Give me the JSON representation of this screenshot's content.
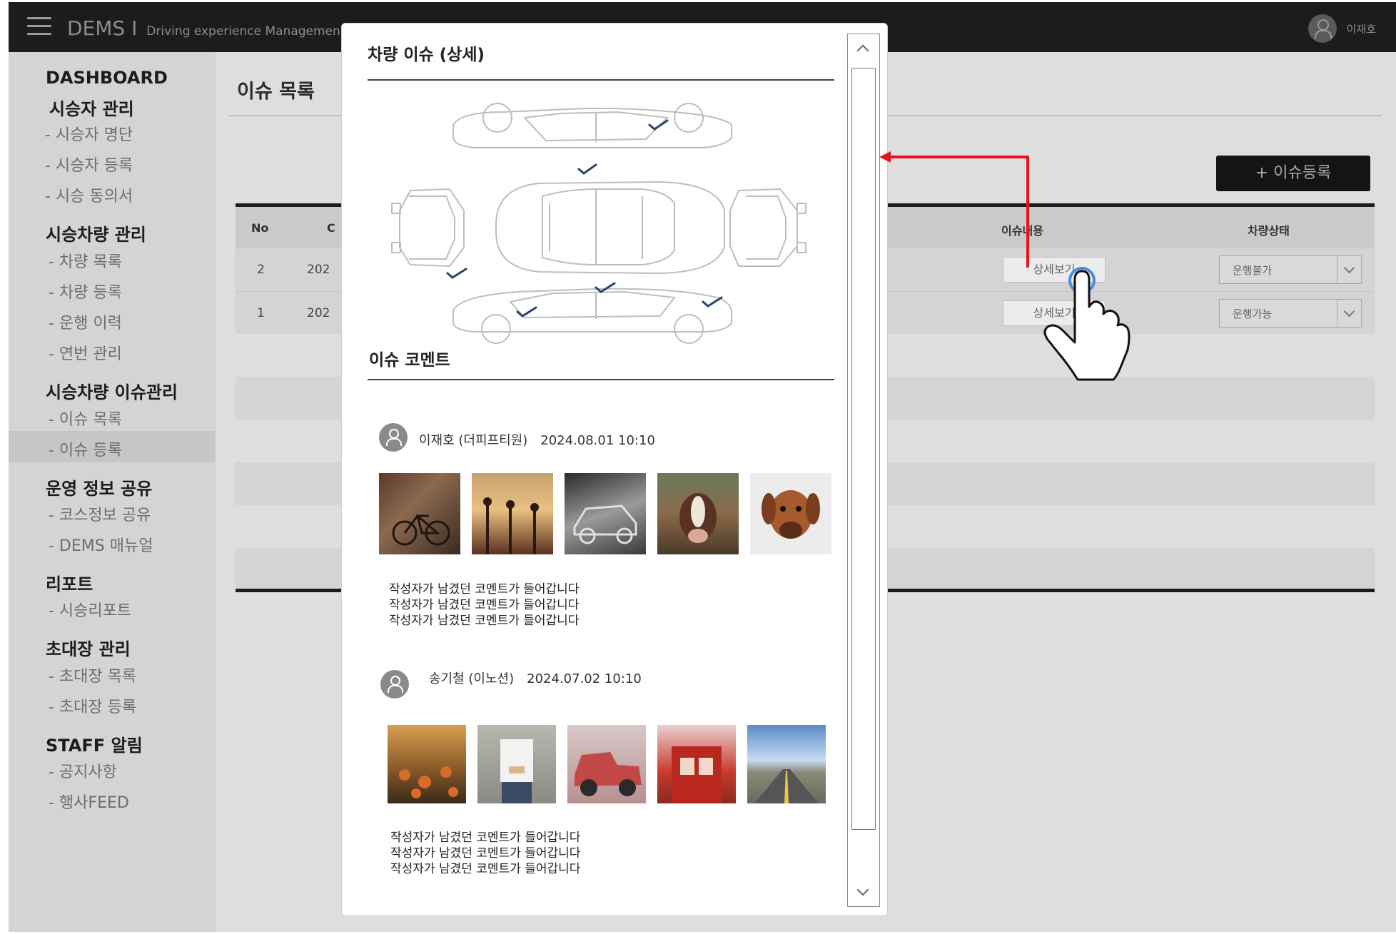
{
  "header": {
    "brand": "DEMS",
    "separator": "I",
    "subtitle": "Driving experience Management",
    "user_name": "이재호"
  },
  "sidebar": {
    "sections": [
      {
        "title": "DASHBOARD",
        "items": []
      },
      {
        "title": "시승자 관리",
        "items": [
          "- 시승자 명단",
          "- 시승자 등록",
          "- 시승 동의서"
        ]
      },
      {
        "title": "시승차량 관리",
        "items": [
          "- 차량 목록",
          "- 차량 등록",
          "- 운행 이력",
          "- 연번 관리"
        ]
      },
      {
        "title": "시승차량 이슈관리",
        "items": [
          "- 이슈 목록",
          "- 이슈 등록"
        ]
      },
      {
        "title": "운영 정보 공유",
        "items": [
          "- 코스정보 공유",
          "- DEMS 매뉴얼"
        ]
      },
      {
        "title": "리포트",
        "items": [
          "- 시승리포트"
        ]
      },
      {
        "title": "초대장 관리",
        "items": [
          "- 초대장 목록",
          "- 초대장 등록"
        ]
      },
      {
        "title": "STAFF 알림",
        "items": [
          "- 공지사항",
          "- 행사FEED"
        ]
      }
    ],
    "active_item": "- 이슈 목록"
  },
  "main": {
    "page_title": "이슈 목록",
    "add_button": "+ 이슈등록",
    "table": {
      "headers": {
        "no": "No",
        "date": "C",
        "issue": "이슈내용",
        "status": "차량상태"
      },
      "rows": [
        {
          "no": "2",
          "date": "202",
          "detail": "상세보기",
          "status": "운행불가"
        },
        {
          "no": "1",
          "date": "202",
          "detail": "상세보기",
          "status": "운행가능"
        }
      ]
    }
  },
  "modal": {
    "title": "차량 이슈 (상세)",
    "comments_title": "이슈 코멘트",
    "comments": [
      {
        "author": "이재호 (더피프티원)",
        "time": "2024.08.01 10:10",
        "photos": [
          "bicycle-photo",
          "street-lamps-photo",
          "old-car-photo",
          "cow-photo",
          "dog-photo"
        ],
        "text": [
          "작성자가 남겼던 코멘트가 들어갑니다",
          "작성자가 남겼던 코멘트가 들어갑니다",
          "작성자가 남겼던 코멘트가 들어갑니다"
        ]
      },
      {
        "author": "송기철 (이노션)",
        "time": "2024.07.02 10:10",
        "photos": [
          "flowers-photo",
          "person-photo",
          "red-truck-photo",
          "phone-booth-photo",
          "road-photo"
        ],
        "text": [
          "작성자가 남겼던 코멘트가 들어갑니다",
          "작성자가 남겼던 코멘트가 들어갑니다",
          "작성자가 남겼던 코멘트가 들어갑니다"
        ]
      }
    ]
  },
  "colors": {
    "header_bg": "#1c1c1c",
    "annotation_arrow": "#e8141c",
    "cursor_ring": "#4a8fd8"
  }
}
